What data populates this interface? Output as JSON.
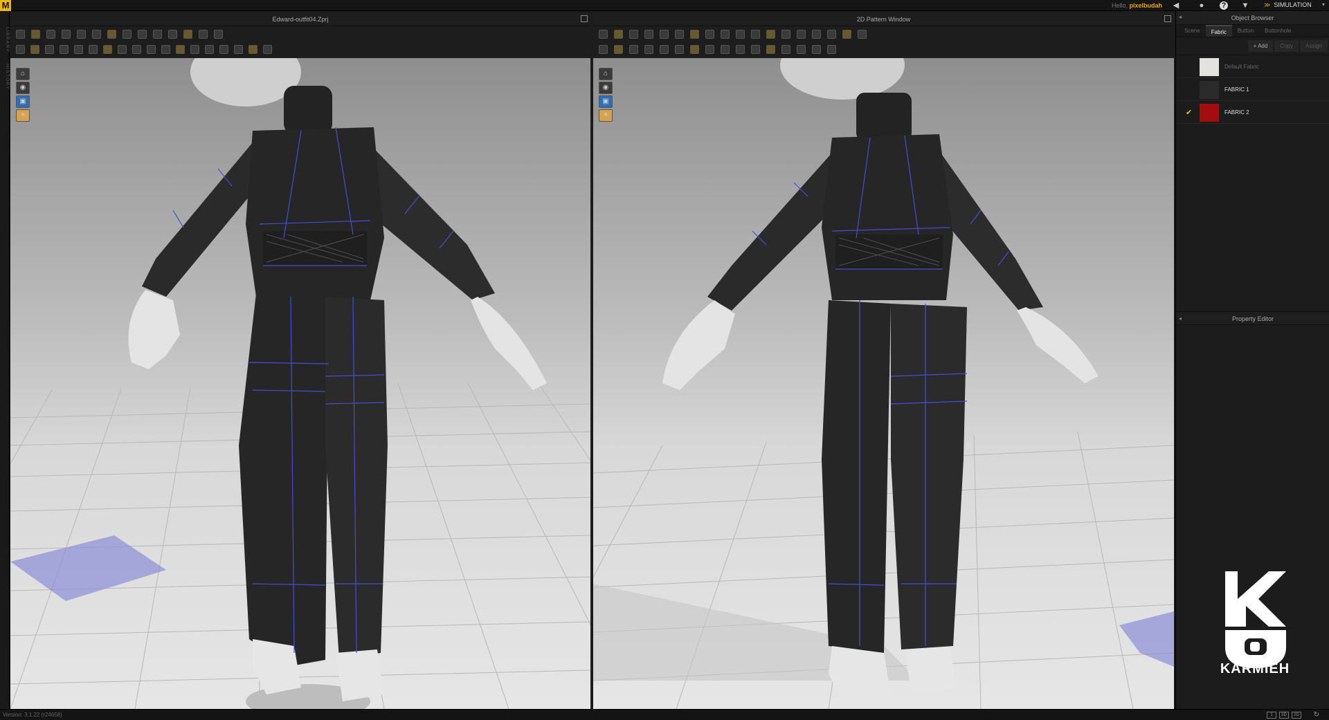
{
  "app": {
    "logo_letter": "M"
  },
  "topbar": {
    "greeting": "Hello,",
    "username": "pixelbudah",
    "icons": [
      "speaker-icon",
      "user-icon",
      "help-icon",
      "cloth-icon"
    ],
    "mode_label": "SIMULATION"
  },
  "left_rail": {
    "tabs": [
      "LIBRARY",
      "HISTORY"
    ]
  },
  "left_pane": {
    "title": "Edward-outfit04.Zprj"
  },
  "right_pane": {
    "title": "2D Pattern Window"
  },
  "object_browser": {
    "title": "Object Browser",
    "tabs": [
      "Scene",
      "Fabric",
      "Button",
      "Buttonhole"
    ],
    "active_tab": "Fabric",
    "buttons": {
      "add": "+ Add",
      "copy": "Copy",
      "assign": "Assign"
    },
    "fabrics": [
      {
        "name": "Default Fabric",
        "color": "#e4e2df",
        "selected": false,
        "dim": true
      },
      {
        "name": "FABRIC 1",
        "color": "#2b2b2b",
        "selected": false,
        "dim": false
      },
      {
        "name": "FABRIC 2",
        "color": "#a30d0d",
        "selected": true,
        "dim": false
      }
    ]
  },
  "property_editor": {
    "title": "Property Editor"
  },
  "watermark": {
    "name": "KARMIEH"
  },
  "statusbar": {
    "version": "Version: 3.1.22   (r24658)",
    "view_buttons": [
      "1",
      "3D",
      "2D"
    ]
  },
  "colors": {
    "accent": "#f2b705",
    "stitch": "#4b4bd8",
    "garment": "#262626"
  }
}
